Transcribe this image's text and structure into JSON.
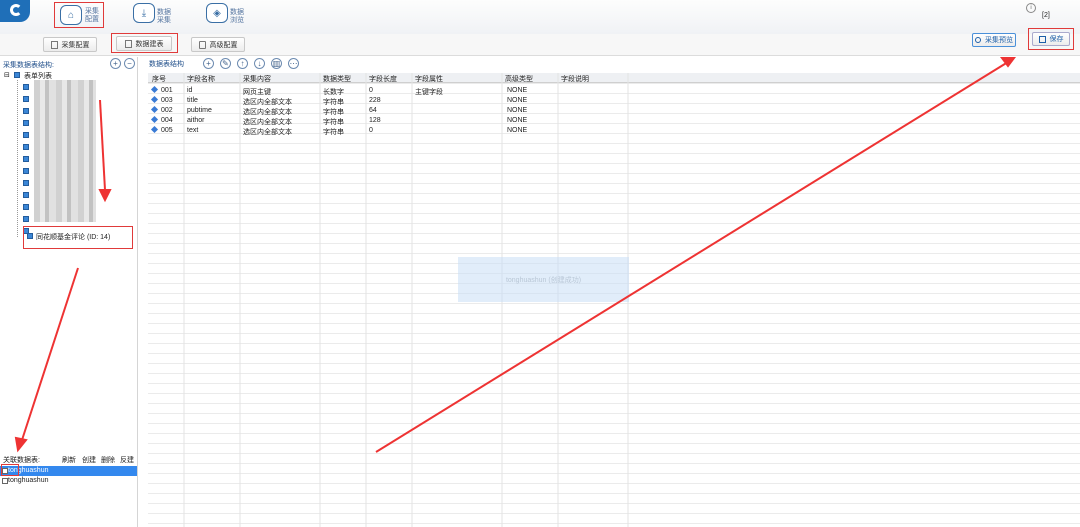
{
  "top_nav": [
    {
      "icon": "house-icon",
      "label": "采集\n配置"
    },
    {
      "icon": "download-icon",
      "label": "数据\n采集"
    },
    {
      "icon": "layers-icon",
      "label": "数据\n浏览"
    }
  ],
  "window_badge": "[2]",
  "sub_toolbar": {
    "collect_config": "采集配置",
    "data_table": "数据建表",
    "advanced_config": "高级配置",
    "preview": "采集预览",
    "save": "保存"
  },
  "left_panel": {
    "title": "采集数据表结构:",
    "root_label": "表单列表",
    "highlight_node": "同花顺基金评论 (ID: 14)"
  },
  "right_panel": {
    "title": "数据表结构"
  },
  "table": {
    "columns": [
      "序号",
      "字段名称",
      "采集内容",
      "数据类型",
      "字段长度",
      "字段属性",
      "高级类型",
      "字段说明"
    ],
    "rows": [
      [
        "001",
        "id",
        "网页主键",
        "长数字",
        "0",
        "主键字段",
        "NONE",
        ""
      ],
      [
        "003",
        "title",
        "选区内全部文本",
        "字符串",
        "228",
        "",
        "NONE",
        ""
      ],
      [
        "002",
        "pubtime",
        "选区内全部文本",
        "字符串",
        "64",
        "",
        "NONE",
        ""
      ],
      [
        "004",
        "aithor",
        "选区内全部文本",
        "字符串",
        "128",
        "",
        "NONE",
        ""
      ],
      [
        "005",
        "text",
        "选区内全部文本",
        "字符串",
        "0",
        "",
        "NONE",
        ""
      ]
    ]
  },
  "overlay_text": "tonghuashun (创建成功)",
  "associated": {
    "title": "关联数据表:",
    "actions": [
      "刷新",
      "创建",
      "删除",
      "反建"
    ],
    "items": [
      {
        "label": "tonghuashun",
        "selected": true
      },
      {
        "label": "tonghuashun",
        "selected": false
      }
    ]
  }
}
